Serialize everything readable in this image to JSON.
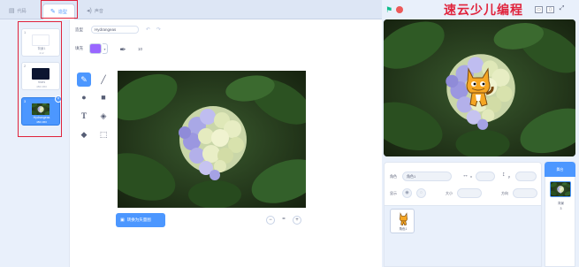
{
  "tabs": [
    {
      "label": "代码",
      "icon": "code-icon"
    },
    {
      "label": "造型",
      "icon": "brush-icon"
    },
    {
      "label": "声音",
      "icon": "sound-icon"
    }
  ],
  "costumes": [
    {
      "num": "1",
      "name": "背景1",
      "size": "2×2"
    },
    {
      "num": "2",
      "name": "Stars",
      "size": "480×360"
    },
    {
      "num": "3",
      "name": "Hydrangeas",
      "size": "480×360"
    }
  ],
  "editor": {
    "costume_label": "造型",
    "costume_name": "Hydrangeas",
    "fill_label": "填充",
    "fill_color": "#9966ff",
    "outline_value": "10",
    "convert_button": "转换为矢量图",
    "zoom_reset": "="
  },
  "watermark": "速云少儿编程",
  "sprite_info": {
    "sprite_label": "角色",
    "sprite_name": "角色1",
    "x_label": "x",
    "x_value": "",
    "y_label": "y",
    "y_value": "",
    "show_label": "显示",
    "size_label": "大小",
    "direction_label": "方向"
  },
  "sprites": [
    {
      "name": "角色1"
    }
  ],
  "stage_pane": {
    "title": "舞台",
    "backdrop_label": "背景",
    "backdrop_count": "3"
  },
  "colors": {
    "accent": "#4c97ff",
    "annotation": "#e0233c",
    "flag": "#0fbd8c",
    "stop": "#ec5959"
  }
}
